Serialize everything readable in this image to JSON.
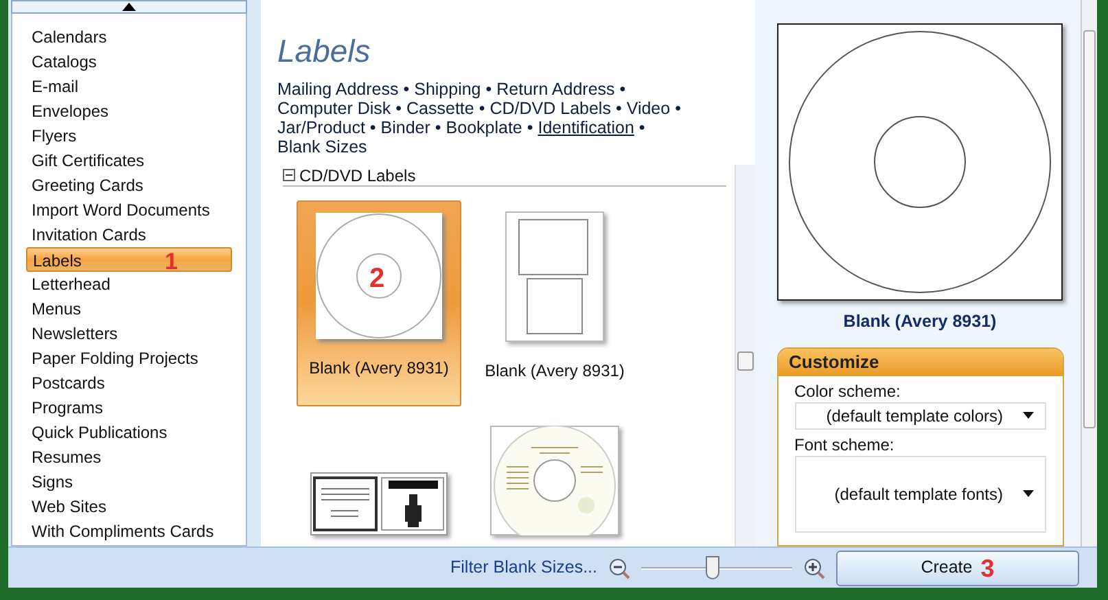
{
  "sidebar": {
    "items": [
      {
        "label": "Calendars",
        "selected": false
      },
      {
        "label": "Catalogs",
        "selected": false
      },
      {
        "label": "E-mail",
        "selected": false
      },
      {
        "label": "Envelopes",
        "selected": false
      },
      {
        "label": "Flyers",
        "selected": false
      },
      {
        "label": "Gift Certificates",
        "selected": false
      },
      {
        "label": "Greeting Cards",
        "selected": false
      },
      {
        "label": "Import Word Documents",
        "selected": false
      },
      {
        "label": "Invitation Cards",
        "selected": false
      },
      {
        "label": "Labels",
        "selected": true,
        "annotation": "1"
      },
      {
        "label": "Letterhead",
        "selected": false
      },
      {
        "label": "Menus",
        "selected": false
      },
      {
        "label": "Newsletters",
        "selected": false
      },
      {
        "label": "Paper Folding Projects",
        "selected": false
      },
      {
        "label": "Postcards",
        "selected": false
      },
      {
        "label": "Programs",
        "selected": false
      },
      {
        "label": "Quick Publications",
        "selected": false
      },
      {
        "label": "Resumes",
        "selected": false
      },
      {
        "label": "Signs",
        "selected": false
      },
      {
        "label": "Web Sites",
        "selected": false
      },
      {
        "label": "With Compliments Cards",
        "selected": false
      }
    ]
  },
  "main": {
    "title": "Labels",
    "separator": "•",
    "categories": [
      {
        "text": "Mailing Address",
        "underlined": false
      },
      {
        "text": "Shipping",
        "underlined": false
      },
      {
        "text": "Return Address",
        "underlined": false
      },
      {
        "text": "Computer Disk",
        "underlined": false
      },
      {
        "text": "Cassette",
        "underlined": false
      },
      {
        "text": "CD/DVD Labels",
        "underlined": false
      },
      {
        "text": "Video",
        "underlined": false
      },
      {
        "text": "Jar/Product",
        "underlined": false
      },
      {
        "text": "Binder",
        "underlined": false
      },
      {
        "text": "Bookplate",
        "underlined": false
      },
      {
        "text": "Identification",
        "underlined": true
      },
      {
        "text": "Blank Sizes",
        "underlined": false
      }
    ],
    "section": {
      "title": "CD/DVD Labels",
      "expanded": true
    },
    "templates": [
      {
        "kind": "cd",
        "caption": "Blank (Avery 8931)",
        "selected": true,
        "annotation": "2"
      },
      {
        "kind": "sheet",
        "caption": "Blank (Avery 8931)",
        "selected": false
      },
      {
        "kind": "case",
        "selected": false
      },
      {
        "kind": "design",
        "selected": false
      }
    ]
  },
  "preview": {
    "caption": "Blank (Avery 8931)"
  },
  "customize": {
    "title": "Customize",
    "fields": [
      {
        "label": "Color scheme:",
        "value": "(default template colors)"
      },
      {
        "label": "Font scheme:",
        "value": "(default template fonts)"
      }
    ]
  },
  "bottom_bar": {
    "filter_link": "Filter Blank Sizes...",
    "zoom": {
      "level": 0.47
    },
    "create_button": "Create",
    "annotation": "3"
  }
}
